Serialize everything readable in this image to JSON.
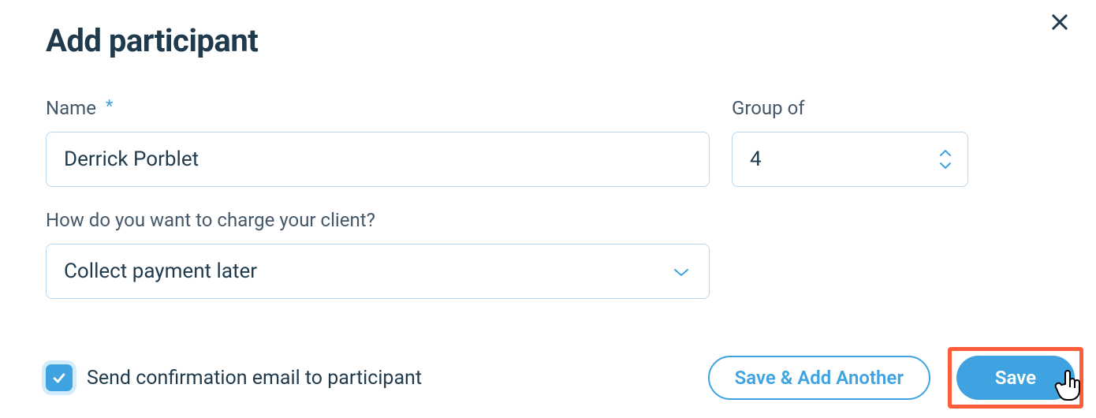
{
  "modal": {
    "title": "Add participant",
    "name_label": "Name",
    "name_required_mark": "*",
    "name_value": "Derrick Porblet",
    "group_label": "Group of",
    "group_value": "4",
    "charge_label": "How do you want to charge your client?",
    "charge_value": "Collect payment later",
    "confirm_label": "Send confirmation email to participant",
    "confirm_checked": true,
    "save_add_label": "Save & Add Another",
    "save_label": "Save"
  }
}
